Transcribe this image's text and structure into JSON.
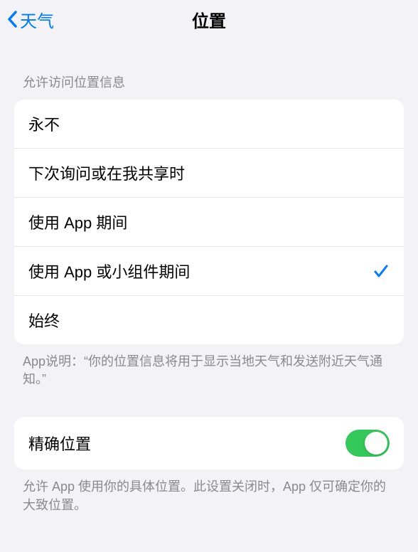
{
  "nav": {
    "back_label": "天气",
    "title": "位置"
  },
  "section1": {
    "header": "允许访问位置信息",
    "options": [
      {
        "label": "永不",
        "selected": false
      },
      {
        "label": "下次询问或在我共享时",
        "selected": false
      },
      {
        "label": "使用 App 期间",
        "selected": false
      },
      {
        "label": "使用 App 或小组件期间",
        "selected": true
      },
      {
        "label": "始终",
        "selected": false
      }
    ],
    "footer": "App说明：“你的位置信息将用于显示当地天气和发送附近天气通知。”"
  },
  "section2": {
    "precise_label": "精确位置",
    "precise_enabled": true,
    "footer": "允许 App 使用你的具体位置。此设置关闭时，App 仅可确定你的大致位置。"
  }
}
